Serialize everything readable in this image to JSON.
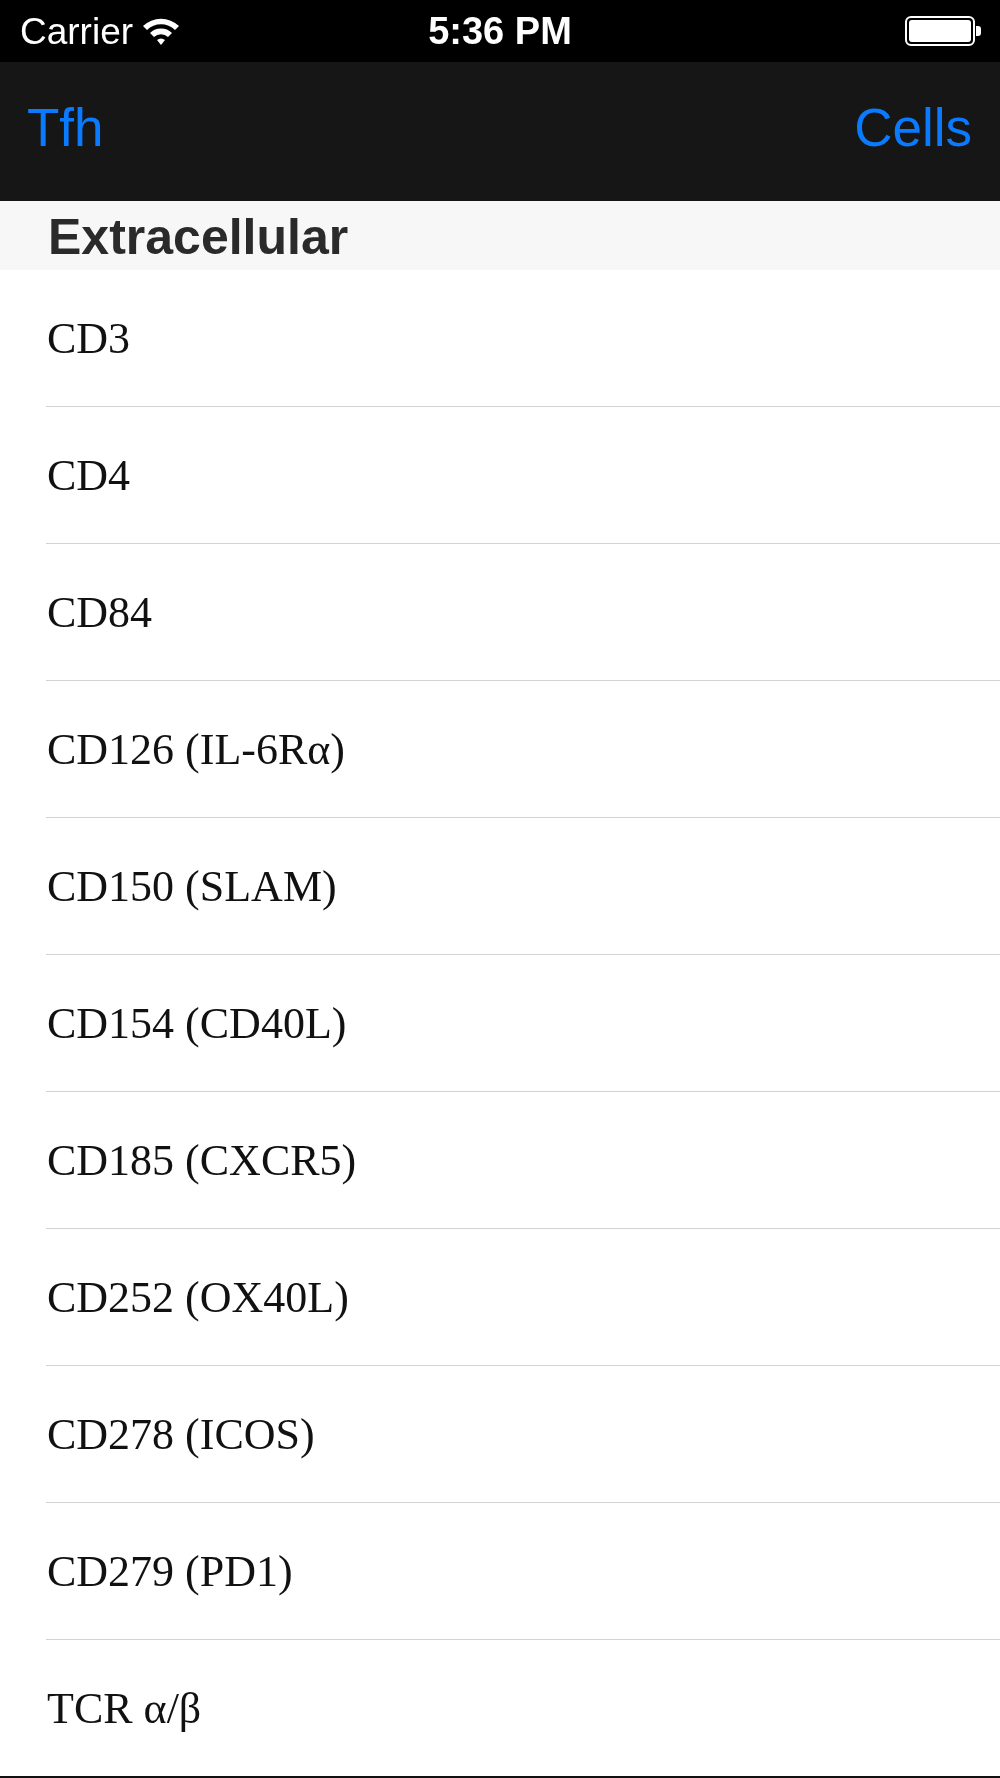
{
  "status_bar": {
    "carrier": "Carrier",
    "time": "5:36 PM"
  },
  "nav_bar": {
    "left_button": "Tfh",
    "right_button": "Cells"
  },
  "section": {
    "title": "Extracellular",
    "rows": [
      "CD3",
      "CD4",
      "CD84",
      "CD126 (IL-6Rα)",
      "CD150 (SLAM)",
      "CD154 (CD40L)",
      "CD185 (CXCR5)",
      "CD252 (OX40L)",
      "CD278 (ICOS)",
      "CD279 (PD1)",
      "TCR α/β"
    ]
  }
}
